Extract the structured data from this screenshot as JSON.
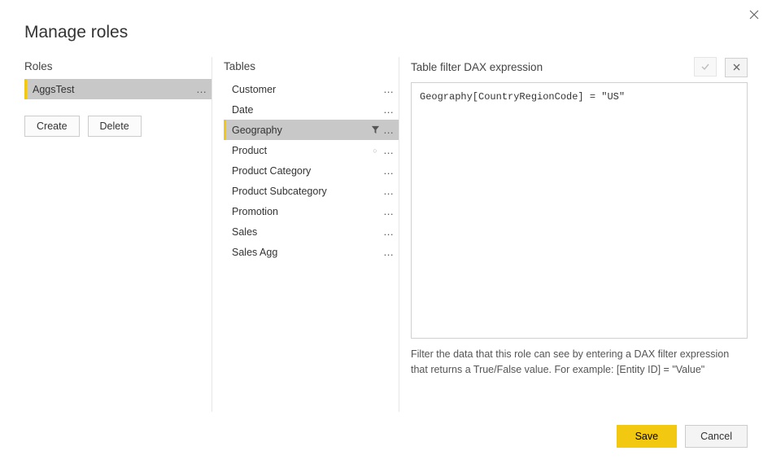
{
  "dialog": {
    "title": "Manage roles"
  },
  "roles": {
    "header": "Roles",
    "items": [
      {
        "label": "AggsTest",
        "selected": true
      }
    ],
    "create_label": "Create",
    "delete_label": "Delete"
  },
  "tables": {
    "header": "Tables",
    "items": [
      {
        "label": "Customer",
        "selected": false,
        "has_filter": false,
        "has_circle": false
      },
      {
        "label": "Date",
        "selected": false,
        "has_filter": false,
        "has_circle": false
      },
      {
        "label": "Geography",
        "selected": true,
        "has_filter": true,
        "has_circle": false
      },
      {
        "label": "Product",
        "selected": false,
        "has_filter": false,
        "has_circle": true
      },
      {
        "label": "Product Category",
        "selected": false,
        "has_filter": false,
        "has_circle": false
      },
      {
        "label": "Product Subcategory",
        "selected": false,
        "has_filter": false,
        "has_circle": false
      },
      {
        "label": "Promotion",
        "selected": false,
        "has_filter": false,
        "has_circle": false
      },
      {
        "label": "Sales",
        "selected": false,
        "has_filter": false,
        "has_circle": false
      },
      {
        "label": "Sales Agg",
        "selected": false,
        "has_filter": false,
        "has_circle": false
      }
    ]
  },
  "expression": {
    "header": "Table filter DAX expression",
    "accept_tooltip": "Accept",
    "revert_tooltip": "Revert",
    "value": "Geography[CountryRegionCode] = \"US\"",
    "help": "Filter the data that this role can see by entering a DAX filter expression that returns a True/False value. For example: [Entity ID] = \"Value\""
  },
  "footer": {
    "save_label": "Save",
    "cancel_label": "Cancel"
  }
}
